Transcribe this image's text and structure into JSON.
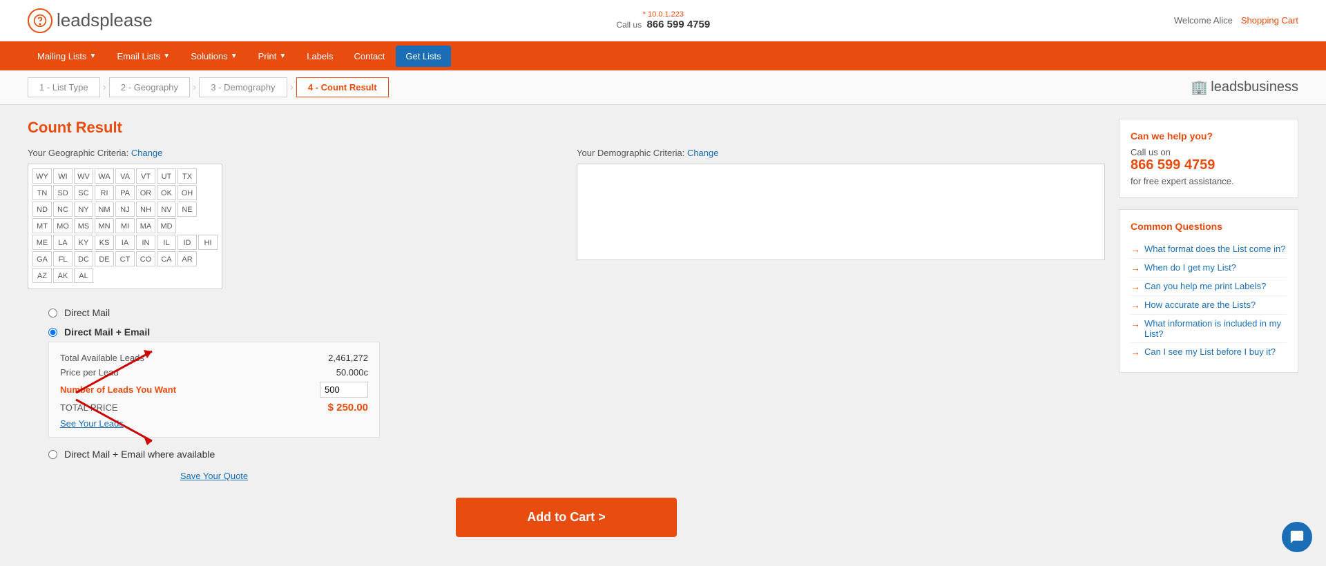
{
  "meta": {
    "ip": "* 10.0.1.223",
    "call_label": "Call us",
    "phone": "866 599 4759",
    "welcome": "Welcome Alice",
    "shopping_cart": "Shopping Cart"
  },
  "logo": {
    "brand": "leads",
    "brand2": "please"
  },
  "nav": {
    "items": [
      {
        "label": "Mailing Lists",
        "has_arrow": true
      },
      {
        "label": "Email Lists",
        "has_arrow": true
      },
      {
        "label": "Solutions",
        "has_arrow": true
      },
      {
        "label": "Print",
        "has_arrow": true
      },
      {
        "label": "Labels",
        "has_arrow": false
      },
      {
        "label": "Contact",
        "has_arrow": false
      },
      {
        "label": "Get Lists",
        "has_arrow": false,
        "special": true
      }
    ]
  },
  "breadcrumb": {
    "steps": [
      {
        "label": "1 - List Type"
      },
      {
        "label": "2 - Geography"
      },
      {
        "label": "3 - Demography"
      },
      {
        "label": "4 - Count Result",
        "active": true
      }
    ]
  },
  "leads_business": {
    "text1": "leads",
    "text2": "business"
  },
  "main": {
    "title": "Count Result",
    "geographic_label": "Your Geographic Criteria:",
    "geographic_change": "Change",
    "demographic_label": "Your Demographic Criteria:",
    "demographic_change": "Change",
    "states": [
      [
        "WY",
        "WI",
        "WV",
        "WA",
        "VA",
        "VT",
        "UT",
        "TX"
      ],
      [
        "TN",
        "SD",
        "SC",
        "RI",
        "PA",
        "OR",
        "OK",
        "OH"
      ],
      [
        "ND",
        "NC",
        "NY",
        "NM",
        "NJ",
        "NH",
        "NV",
        "NE"
      ],
      [
        "MT",
        "MO",
        "MS",
        "MN",
        "MI",
        "MA",
        "MD",
        ""
      ],
      [
        "ME",
        "LA",
        "KY",
        "KS",
        "IA",
        "IN",
        "IL",
        "ID",
        "HI"
      ],
      [
        "GA",
        "FL",
        "DC",
        "DE",
        "CT",
        "CO",
        "CA",
        "AR"
      ],
      [
        "AZ",
        "AK",
        "AL"
      ]
    ],
    "options": [
      {
        "id": "direct_mail",
        "label": "Direct Mail",
        "selected": false
      },
      {
        "id": "direct_mail_email",
        "label": "Direct Mail + Email",
        "selected": true,
        "details": {
          "total_leads_label": "Total Available Leads",
          "total_leads_value": "2,461,272",
          "price_per_lead_label": "Price per Lead",
          "price_per_lead_value": "50.000c",
          "num_leads_label": "Number of Leads You Want",
          "num_leads_value": "500",
          "total_price_label": "TOTAL PRICE",
          "total_price_value": "$ 250.00",
          "see_leads_label": "See Your Leads"
        }
      },
      {
        "id": "direct_mail_email_available",
        "label": "Direct Mail + Email where available",
        "selected": false
      }
    ],
    "save_quote": "Save Your Quote",
    "add_to_cart": "Add to Cart >"
  },
  "sidebar": {
    "help": {
      "title": "Can we help you?",
      "call_label": "Call us on",
      "phone": "866 599 4759",
      "sub": "for free expert assistance."
    },
    "questions": {
      "title": "Common Questions",
      "items": [
        "What format does the List come in?",
        "When do I get my List?",
        "Can you help me print Labels?",
        "How accurate are the Lists?",
        "What information is included in my List?",
        "Can I see my List before I buy it?"
      ]
    }
  }
}
